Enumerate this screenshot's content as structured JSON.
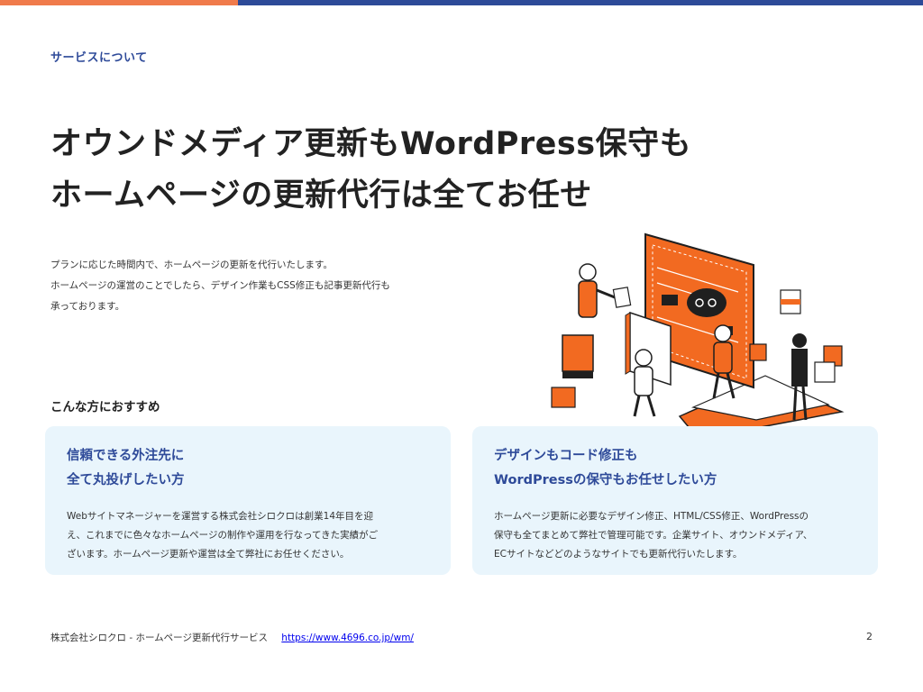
{
  "colors": {
    "bar_orange": "#F07B4B",
    "bar_navy": "#2D4A98",
    "accent_blue": "#2E4A99",
    "card_bg": "#E9F5FC",
    "illus_orange": "#F26A21",
    "illus_dark": "#1F1F1F"
  },
  "eyebrow": "サービスについて",
  "headline": {
    "line1": "オウンドメディア更新もWordPress保守も",
    "line2": "ホームページの更新代行は全てお任せ"
  },
  "intro": {
    "line1": "プランに応じた時間内で、ホームページの更新を代行いたします。",
    "line2": "ホームページの運営のことでしたら、デザイン作業もCSS修正も記事更新代行も",
    "line3": "承っております。"
  },
  "recommend_label": "こんな方におすすめ",
  "cards": [
    {
      "title_line1": "信頼できる外注先に",
      "title_line2": "全て丸投げしたい方",
      "body_line1": "Webサイトマネージャーを運営する株式会社シロクロは創業14年目を迎",
      "body_line2": "え、これまでに色々なホームページの制作や運用を行なってきた実績がご",
      "body_line3": "ざいます。ホームページ更新や運営は全て弊社にお任せください。"
    },
    {
      "title_line1": "デザインもコード修正も",
      "title_line2": "WordPressの保守もお任せしたい方",
      "body_line1": "ホームページ更新に必要なデザイン修正、HTML/CSS修正、WordPressの",
      "body_line2": "保守も全てまとめて弊社で管理可能です。企業サイト、オウンドメディア、",
      "body_line3": "ECサイトなどどのようなサイトでも更新代行いたします。"
    }
  ],
  "footer": {
    "company": "株式会社シロクロ - ホームページ更新代行サービス",
    "url": "https://www.4696.co.jp/wm/",
    "page_number": "2"
  },
  "illustration": {
    "icon": "robots-web-workspace-illustration"
  }
}
